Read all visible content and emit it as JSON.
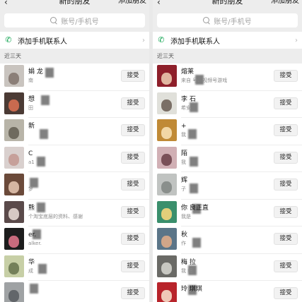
{
  "panels": [
    {
      "header": {
        "back_icon": "back-arrow-icon",
        "title": "新的朋友",
        "add_label": "添加朋友"
      },
      "search": {
        "placeholder": "账号/手机号",
        "icon": "search-icon"
      },
      "phone_contacts": {
        "label": "添加手机联系人",
        "icon": "phone-icon",
        "chevron": "›"
      },
      "section_header": "近三天",
      "accept_label": "接受",
      "requests": [
        {
          "name": "娟  龙",
          "sub": "南",
          "avatar_colors": [
            "#c9c4bf",
            "#8b7f78"
          ],
          "pix": [
            24,
            4
          ]
        },
        {
          "name": "想",
          "sub": "田",
          "avatar_colors": [
            "#4b3b35",
            "#c86a4f"
          ],
          "pix": [
            18,
            4
          ]
        },
        {
          "name": "新",
          "sub": "",
          "avatar_colors": [
            "#b8b4a8",
            "#6f6a5e"
          ],
          "pix": [
            16,
            14
          ]
        },
        {
          "name": "C",
          "sub": "a1",
          "avatar_colors": [
            "#d9d0ce",
            "#c6a09a"
          ],
          "pix": [
            12,
            14
          ]
        },
        {
          "name": "",
          "sub": "梦",
          "avatar_colors": [
            "#6b4a3a",
            "#d5b6a2"
          ],
          "pix": [
            2,
            6
          ]
        },
        {
          "name": "  熊",
          "sub": "个淘宝底层的资料、感谢",
          "avatar_colors": [
            "#5a4a4a",
            "#d6c9c4"
          ],
          "pix": [
            12,
            2
          ]
        },
        {
          "name": "er.",
          "sub": "alker.",
          "avatar_colors": [
            "#1d1d1d",
            "#c86b7d"
          ],
          "pix": [
            6,
            2
          ]
        },
        {
          "name": "华",
          "sub": "成",
          "avatar_colors": [
            "#c7cfa6",
            "#74805a"
          ],
          "pix": [
            14,
            12
          ]
        },
        {
          "name": "",
          "sub": "",
          "avatar_colors": [
            "#9fa2a4",
            "#62666a"
          ],
          "pix": [
            2,
            2
          ]
        }
      ]
    },
    {
      "header": {
        "back_icon": "back-arrow-icon",
        "title": "新的朋友",
        "add_label": "添加朋友"
      },
      "search": {
        "placeholder": "账号/手机号",
        "icon": "search-icon"
      },
      "phone_contacts": {
        "label": "添加手机联系人",
        "icon": "phone-icon",
        "chevron": "›"
      },
      "section_header": "近三天",
      "accept_label": "接受",
      "requests": [
        {
          "name": "熔莱",
          "sub": "来自  号、视频号游戏",
          "avatar_colors": [
            "#8e1f2a",
            "#e1b6a0"
          ],
          "pix": [
            20,
            14
          ]
        },
        {
          "name": "李 石",
          "sub": "  希安",
          "avatar_colors": [
            "#e0e0da",
            "#7a6f66"
          ],
          "pix": [
            12,
            14
          ]
        },
        {
          "name": "+",
          "sub": "我",
          "avatar_colors": [
            "#c08a36",
            "#f2d7a5"
          ],
          "pix": [
            10,
            14
          ]
        },
        {
          "name": "陌",
          "sub": "我",
          "avatar_colors": [
            "#d1b0b5",
            "#7a5058"
          ],
          "pix": [
            12,
            14
          ]
        },
        {
          "name": "辉",
          "sub": "  子",
          "avatar_colors": [
            "#c0c3c1",
            "#8a8f8c"
          ],
          "pix": [
            12,
            14
          ]
        },
        {
          "name": "你  良正直",
          "sub": "我是",
          "avatar_colors": [
            "#3a8f6c",
            "#e2cf7a"
          ],
          "pix": [
            16,
            4
          ]
        },
        {
          "name": "秋",
          "sub": "作",
          "avatar_colors": [
            "#5b7588",
            "#d1a689"
          ],
          "pix": [
            16,
            14
          ]
        },
        {
          "name": "梅  拉",
          "sub": "我  细",
          "avatar_colors": [
            "#6a6a66",
            "#c8c8c2"
          ],
          "pix": [
            10,
            14
          ]
        },
        {
          "name": "玲  琪琪",
          "sub": "",
          "avatar_colors": [
            "#b8242b",
            "#f0c9b7"
          ],
          "pix": [
            10,
            4
          ]
        }
      ]
    }
  ]
}
